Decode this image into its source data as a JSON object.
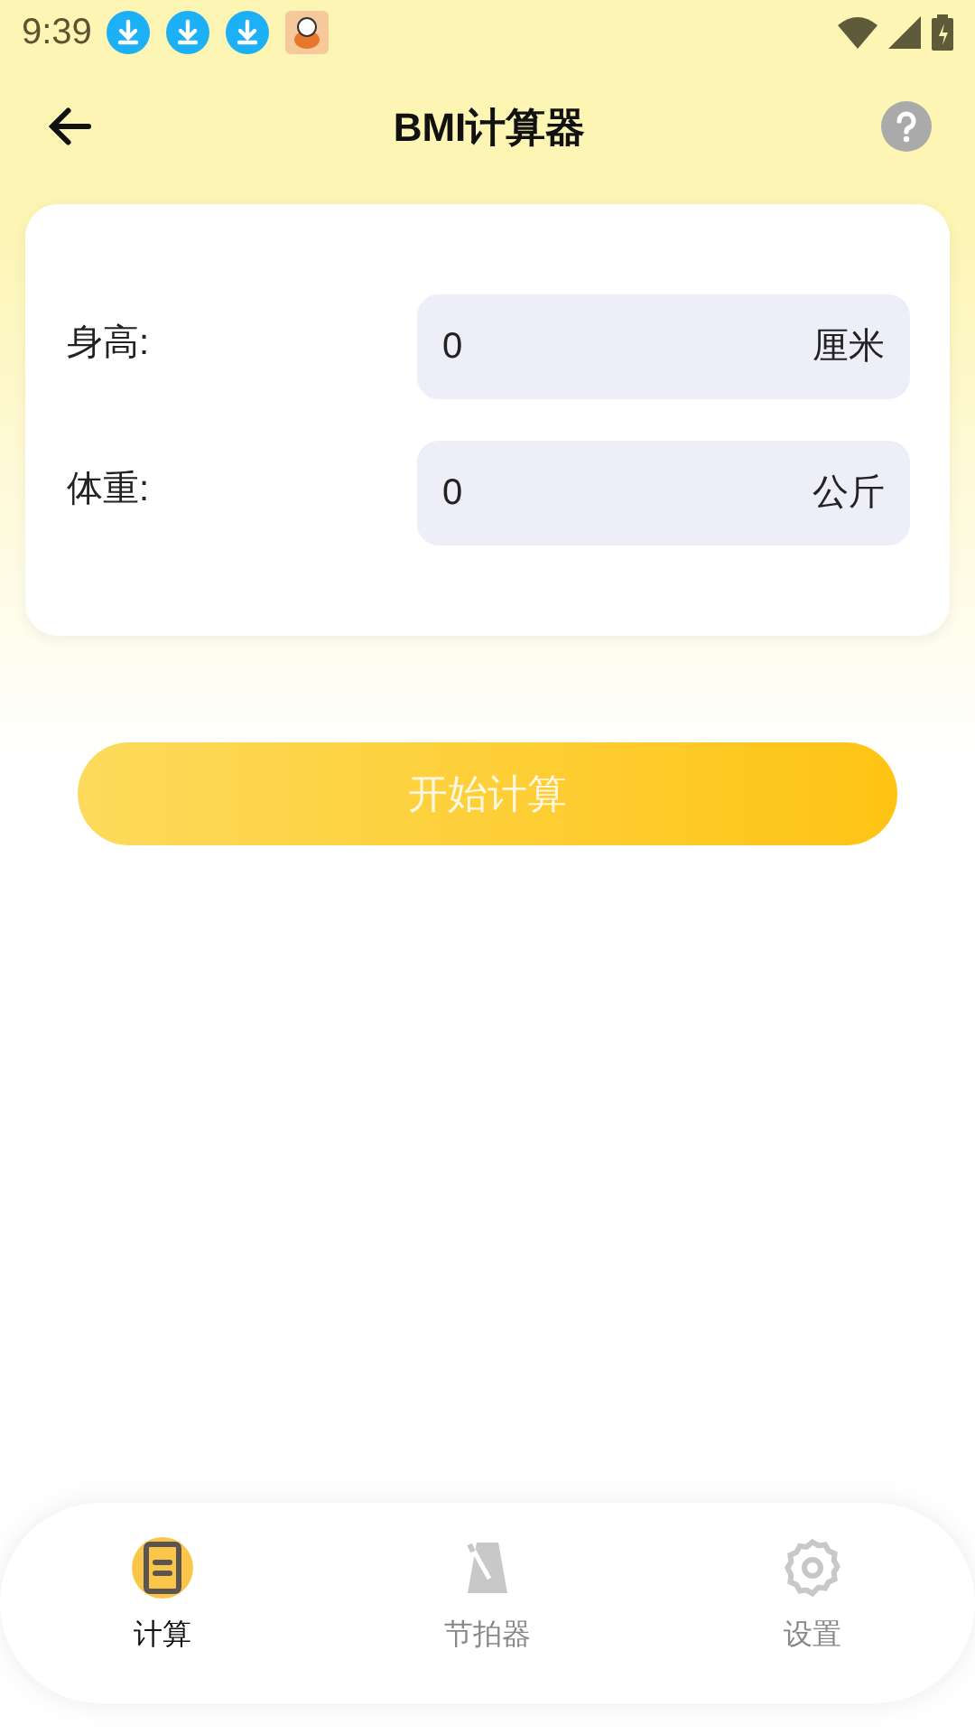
{
  "status_bar": {
    "time": "9:39",
    "notifications": [
      {
        "kind": "download"
      },
      {
        "kind": "download"
      },
      {
        "kind": "download"
      },
      {
        "kind": "app"
      }
    ]
  },
  "header": {
    "title": "BMI计算器"
  },
  "form": {
    "fields": [
      {
        "label": "身高:",
        "value": "0",
        "unit": "厘米"
      },
      {
        "label": "体重:",
        "value": "0",
        "unit": "公斤"
      }
    ]
  },
  "calculate_button": "开始计算",
  "bottom_nav": [
    {
      "label": "计算",
      "kind": "calculator",
      "selected": true
    },
    {
      "label": "节拍器",
      "kind": "metronome",
      "selected": false
    },
    {
      "label": "设置",
      "kind": "settings",
      "selected": false
    }
  ]
}
